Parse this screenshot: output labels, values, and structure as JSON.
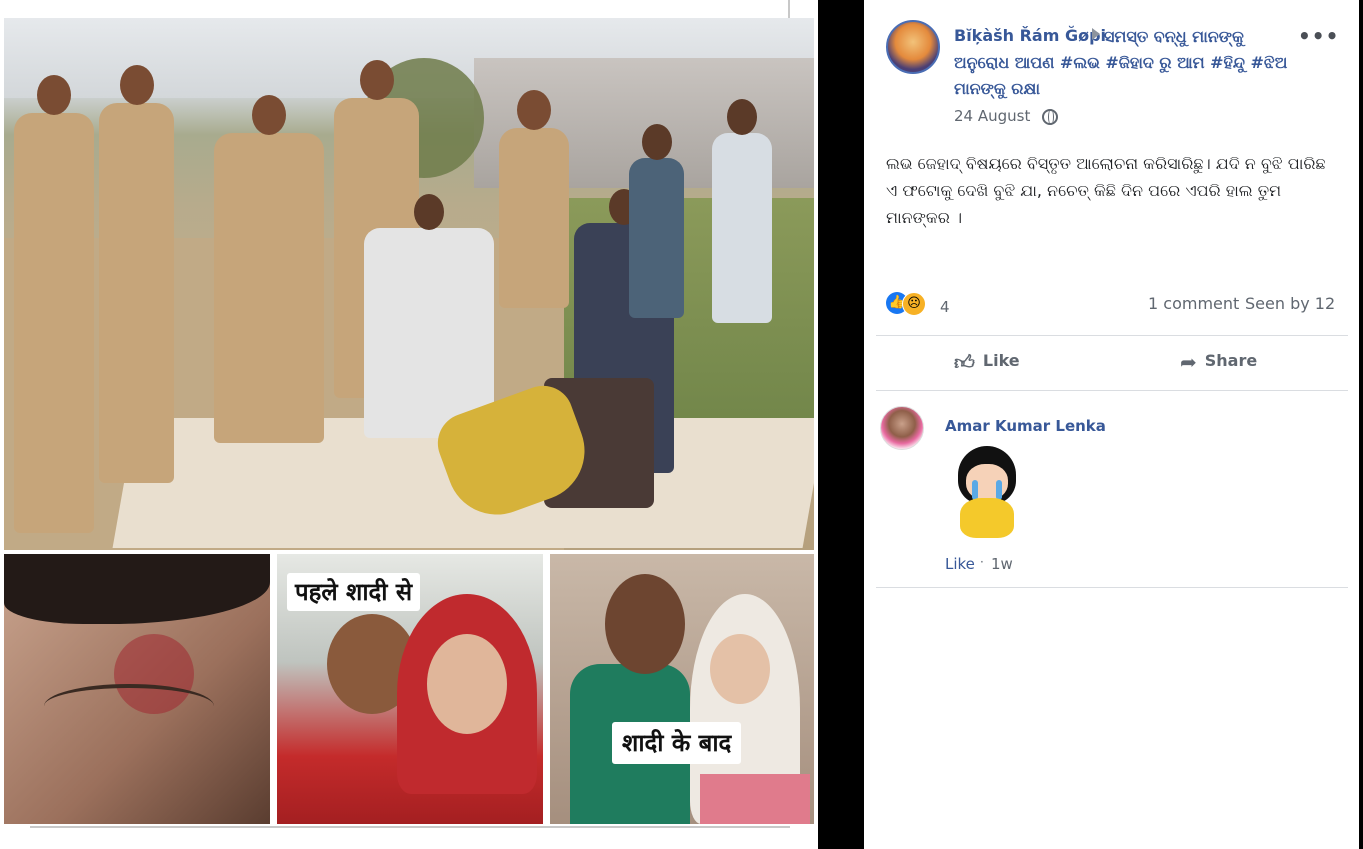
{
  "post": {
    "author": "Bĭķàšh Řám Ğøpi",
    "target_line1": "ସମସ୍ତ ବନ୍ଧୁ ମାନଙ୍କୁ",
    "target_line2": "ଅନୁରୋଧ ଆପଣ #ଲଭ #ଜିହାଦ ରୁ ଆମ #ହିନ୍ଦୁ #ଝିଅ ମାନଙ୍କୁ ରକ୍ଷା",
    "date": "24 August",
    "more": "•••",
    "text": "ଲଭ ଜେହାଦ୍ ବିଷୟରେ ବିସ୍ତୃତ ଆଲୋଚନା କରିସାରିଛୁ। ଯଦି ନ ବୁଝି ପାରିଛ ଏ ଫଟୋକୁ ଦେଖି ବୁଝି ଯା, ନଚେତ୍ କିଛି ଦିନ ପରେ ଏପରି ହାଲ ତୁମ ମାନଙ୍କର ।",
    "reaction_count": "4",
    "comment_count": "1 comment",
    "seen_by": "Seen by 12",
    "like_label": "Like",
    "share_label": "Share",
    "icons": [
      "like-reaction-icon",
      "sad-reaction-icon",
      "globe-icon",
      "thumbs-up-icon",
      "share-arrow-icon"
    ]
  },
  "comment": {
    "name": "Amar Kumar Lenka",
    "like_label": "Like",
    "separator": "·",
    "time": "1w"
  },
  "image_captions": {
    "before": "पहले शादी से",
    "after": "शादी के बाद"
  },
  "colors": {
    "link": "#385898",
    "secondary_text": "#606770",
    "like_blue": "#1877f2"
  }
}
